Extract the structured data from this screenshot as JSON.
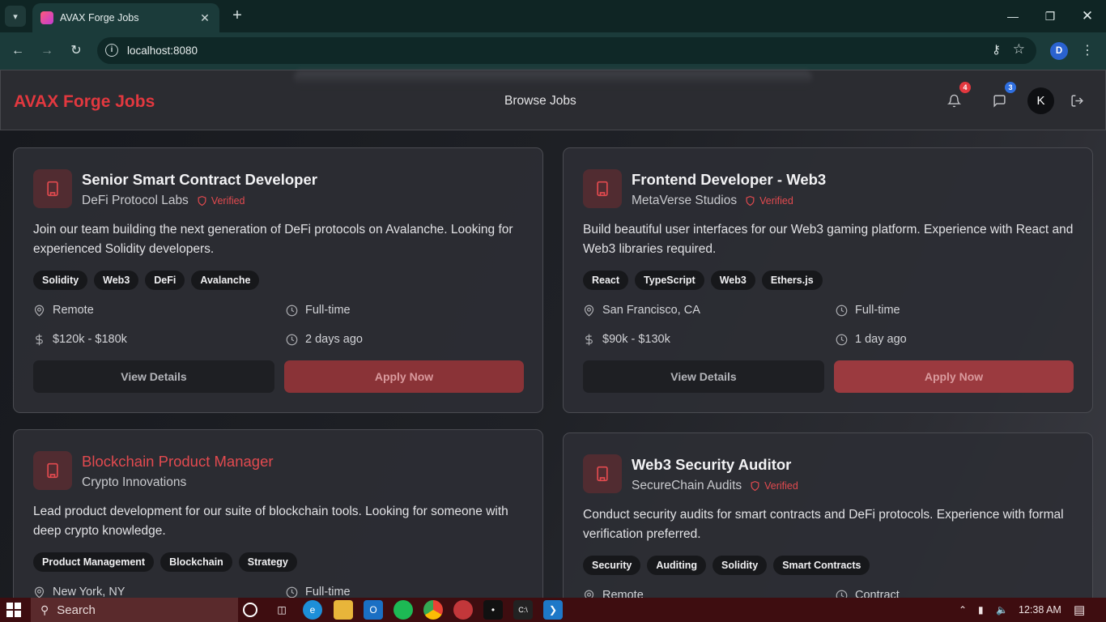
{
  "browser": {
    "tab_title": "AVAX Forge Jobs",
    "url": "localhost:8080",
    "profile_initial": "D"
  },
  "header": {
    "brand": "AVAX Forge Jobs",
    "nav": "Browse Jobs",
    "notifications_count": "4",
    "messages_count": "3",
    "avatar_initial": "K",
    "colors": {
      "brand": "#e2383f",
      "notif_badge": "#e2383f",
      "msg_badge": "#2f6fe0"
    }
  },
  "jobs": [
    {
      "title": "Senior Smart Contract Developer",
      "company": "DeFi Protocol Labs",
      "verified": "Verified",
      "description": "Join our team building the next generation of DeFi protocols on Avalanche. Looking for experienced Solidity developers.",
      "tags": [
        "Solidity",
        "Web3",
        "DeFi",
        "Avalanche"
      ],
      "location": "Remote",
      "type": "Full-time",
      "salary": "$120k - $180k",
      "posted": "2 days ago",
      "view_label": "View Details",
      "apply_label": "Apply Now"
    },
    {
      "title": "Frontend Developer - Web3",
      "company": "MetaVerse Studios",
      "verified": "Verified",
      "description": "Build beautiful user interfaces for our Web3 gaming platform. Experience with React and Web3 libraries required.",
      "tags": [
        "React",
        "TypeScript",
        "Web3",
        "Ethers.js"
      ],
      "location": "San Francisco, CA",
      "type": "Full-time",
      "salary": "$90k - $130k",
      "posted": "1 day ago",
      "view_label": "View Details",
      "apply_label": "Apply Now"
    },
    {
      "title": "Blockchain Product Manager",
      "company": "Crypto Innovations",
      "description": "Lead product development for our suite of blockchain tools. Looking for someone with deep crypto knowledge.",
      "tags": [
        "Product Management",
        "Blockchain",
        "Strategy"
      ],
      "location": "New York, NY",
      "type": "Full-time"
    },
    {
      "title": "Web3 Security Auditor",
      "company": "SecureChain Audits",
      "verified": "Verified",
      "description": "Conduct security audits for smart contracts and DeFi protocols. Experience with formal verification preferred.",
      "tags": [
        "Security",
        "Auditing",
        "Solidity",
        "Smart Contracts"
      ],
      "location": "Remote",
      "type": "Contract"
    }
  ],
  "taskbar": {
    "search_label": "Search",
    "time": "12:38 AM"
  }
}
